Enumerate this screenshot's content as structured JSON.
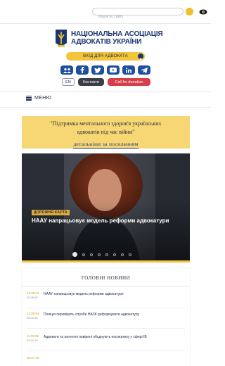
{
  "header": {
    "search_placeholder": "Пошук по сайту"
  },
  "logo": {
    "line1": "НАЦІОНАЛЬНА АСОЦІАЦІЯ",
    "line2": "АДВОКАТІВ УКРАЇНИ"
  },
  "login": {
    "label": "ВХІД ДЛЯ АДВОКАТА"
  },
  "socials": [
    "fb",
    "f",
    "t",
    "yt",
    "in",
    "tg"
  ],
  "actions": {
    "lang": "EN",
    "contacts": "Контакти",
    "donation": "Call for donation"
  },
  "menu": {
    "label": "МЕНЮ"
  },
  "banner": {
    "line1": "\"Підтримка ментального здоров'я українських",
    "line2": "адвокатів під час війни\"",
    "link": "детальніше за посиланням"
  },
  "slider": {
    "tag": "ДОРОЖНЯ КАРТА",
    "title": "НААУ напрацьовує модель реформи адвокатури",
    "slide_count": 8,
    "active_index": 0
  },
  "news": {
    "header": "ГОЛОВНІ НОВИНИ",
    "items": [
      {
        "time": "15:09:04",
        "date": "30.05.26",
        "text": "НААУ напрацьовує модель реформи адвокатури"
      },
      {
        "time": "12:09:04",
        "date": "28.04.26",
        "text": "Поліція перевірить спроби НАЗК реформувати адвокатуру"
      },
      {
        "time": "11:05:06",
        "date": "30.04.26",
        "text": "Адвокати та патентні повірені обєднують експертизу у сфері IB"
      },
      {
        "time": "08:07:26",
        "date": "",
        "text": ""
      }
    ]
  },
  "colors": {
    "navy": "#1d3572",
    "gold": "#f2c53a",
    "social_blue": "#1d4f9c",
    "donation_red": "#d63e4a",
    "banner_yellow": "#f6d774"
  }
}
